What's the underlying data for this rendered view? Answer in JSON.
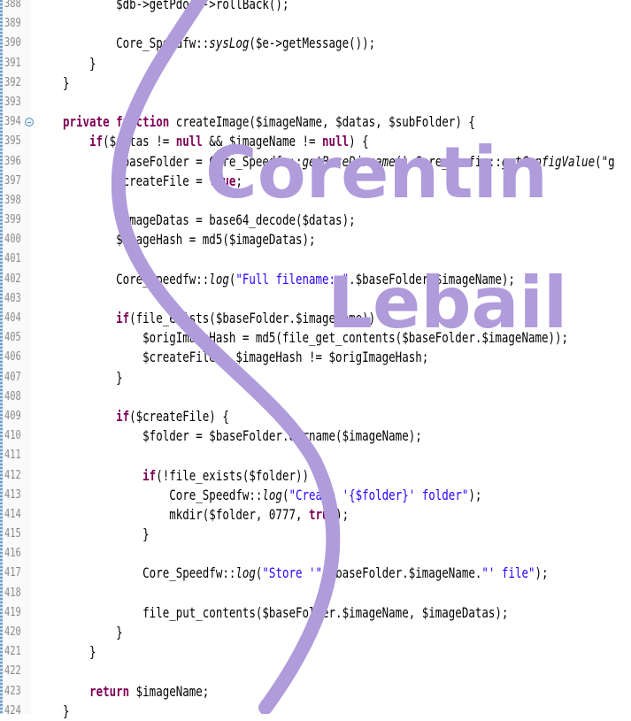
{
  "editor": {
    "lines": [
      {
        "number": "388",
        "code": "        $db->getPdo()->rollBack();"
      },
      {
        "number": "389",
        "code": ""
      },
      {
        "number": "390",
        "code": "        Core_Speedfw::sysLog($e->getMessage());"
      },
      {
        "number": "391",
        "code": "    }"
      },
      {
        "number": "392",
        "code": "}"
      },
      {
        "number": "393",
        "code": ""
      },
      {
        "number": "394",
        "code": "private function createImage($imageName, $datas, $subFolder) {"
      },
      {
        "number": "395",
        "code": "    if($datas != null && $imageName != null) {"
      },
      {
        "number": "396",
        "code": "        $baseFolder = Core_Speedfw::getBaseDirname().Core_Config::getConfigValue(\"g"
      },
      {
        "number": "397",
        "code": "        $createFile = true;"
      },
      {
        "number": "398",
        "code": ""
      },
      {
        "number": "399",
        "code": "        $imageDatas = base64_decode($datas);"
      },
      {
        "number": "400",
        "code": "        $imageHash = md5($imageDatas);"
      },
      {
        "number": "401",
        "code": ""
      },
      {
        "number": "402",
        "code": "        Core_Speedfw::log(\"Full filename: \".$baseFolder.$imageName);"
      },
      {
        "number": "403",
        "code": ""
      },
      {
        "number": "404",
        "code": "        if(file_exists($baseFolder.$imageName)) {"
      },
      {
        "number": "405",
        "code": "            $origImageHash = md5(file_get_contents($baseFolder.$imageName));"
      },
      {
        "number": "406",
        "code": "            $createFile = $imageHash != $origImageHash;"
      },
      {
        "number": "407",
        "code": "        }"
      },
      {
        "number": "408",
        "code": ""
      },
      {
        "number": "409",
        "code": "        if($createFile) {"
      },
      {
        "number": "410",
        "code": "            $folder = $baseFolder.dirname($imageName);"
      },
      {
        "number": "411",
        "code": ""
      },
      {
        "number": "412",
        "code": "            if(!file_exists($folder)) {"
      },
      {
        "number": "413",
        "code": "                Core_Speedfw::log(\"Create '{$folder}' folder\");"
      },
      {
        "number": "414",
        "code": "                mkdir($folder, 0777, true);"
      },
      {
        "number": "415",
        "code": "            }"
      },
      {
        "number": "416",
        "code": ""
      },
      {
        "number": "417",
        "code": "            Core_Speedfw::log(\"Store '\".$baseFolder.$imageName.\"' file\");"
      },
      {
        "number": "418",
        "code": ""
      },
      {
        "number": "419",
        "code": "            file_put_contents($baseFolder.$imageName, $imageDatas);"
      },
      {
        "number": "420",
        "code": "        }"
      },
      {
        "number": "421",
        "code": "    }"
      },
      {
        "number": "422",
        "code": ""
      },
      {
        "number": "423",
        "code": "    return $imageName;"
      },
      {
        "number": "424",
        "code": "}"
      }
    ],
    "colors": {
      "text": "#000000",
      "keyword": "#7f0055",
      "method_italic": "#1a1a1a",
      "string": "#2a00ff",
      "line_number": "#8a8a8a",
      "gutter_strip": "#6f9fc9"
    }
  },
  "overlay": {
    "first_name": "Corentin",
    "last_name": "Lebail",
    "color": "#b09bdb"
  }
}
